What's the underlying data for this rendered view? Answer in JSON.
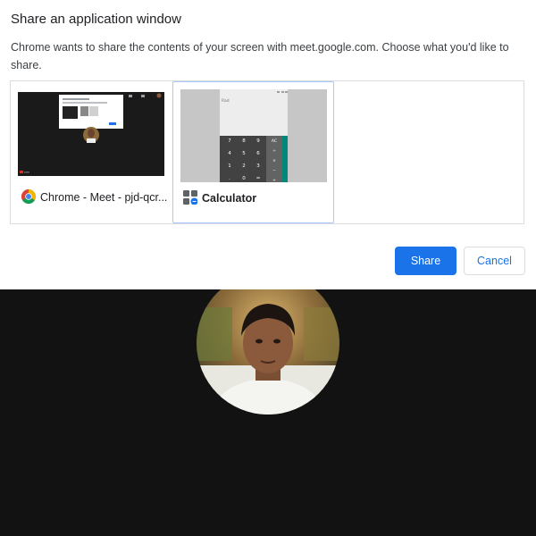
{
  "dialog": {
    "title": "Share an application window",
    "description": "Chrome wants to share the contents of your screen with meet.google.com. Choose what you'd like to share.",
    "windows": [
      {
        "label": "Chrome - Meet - pjd-qcr...",
        "icon": "chrome-icon",
        "selected": false
      },
      {
        "label": "Calculator",
        "icon": "calculator-icon",
        "selected": true
      }
    ],
    "calculator_thumb": {
      "display": "Rad",
      "keys": [
        "7",
        "8",
        "9",
        "4",
        "5",
        "6",
        "1",
        "2",
        "3",
        ".",
        "0",
        "="
      ],
      "side_keys": [
        "AC",
        "÷",
        "×",
        "−",
        "+"
      ]
    },
    "share_label": "Share",
    "cancel_label": "Cancel"
  },
  "colors": {
    "accent": "#1a73e8",
    "selected_border": "#a8c7fa",
    "meet_background": "#121212"
  }
}
